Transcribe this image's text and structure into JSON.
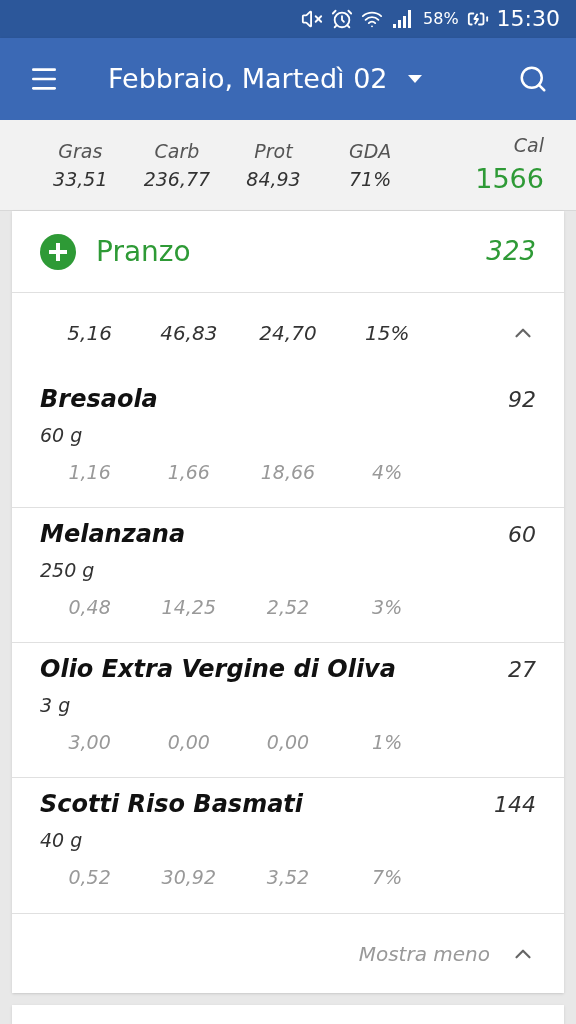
{
  "status_bar": {
    "battery": "58%",
    "time": "15:30"
  },
  "toolbar": {
    "title": "Febbraio, Martedì 02"
  },
  "summary": [
    {
      "label": "Gras",
      "value": "33,51"
    },
    {
      "label": "Carb",
      "value": "236,77"
    },
    {
      "label": "Prot",
      "value": "84,93"
    },
    {
      "label": "GDA",
      "value": "71%"
    },
    {
      "label": "Cal",
      "value": "1566",
      "kind": "calories"
    }
  ],
  "meal": {
    "name": "Pranzo",
    "calories": "323",
    "totals": [
      "5,16",
      "46,83",
      "24,70",
      "15%"
    ],
    "expanded": true,
    "items": [
      {
        "name": "Bresaola",
        "calories": "92",
        "quantity": "60 g",
        "values": [
          "1,16",
          "1,66",
          "18,66",
          "4%"
        ]
      },
      {
        "name": "Melanzana",
        "calories": "60",
        "quantity": "250 g",
        "values": [
          "0,48",
          "14,25",
          "2,52",
          "3%"
        ]
      },
      {
        "name": "Olio Extra Vergine di Oliva",
        "calories": "27",
        "quantity": "3 g",
        "values": [
          "3,00",
          "0,00",
          "0,00",
          "1%"
        ]
      },
      {
        "name": "Scotti Riso Basmati",
        "calories": "144",
        "quantity": "40 g",
        "values": [
          "0,52",
          "30,92",
          "3,52",
          "7%"
        ]
      }
    ],
    "footer": "Mostra meno"
  }
}
